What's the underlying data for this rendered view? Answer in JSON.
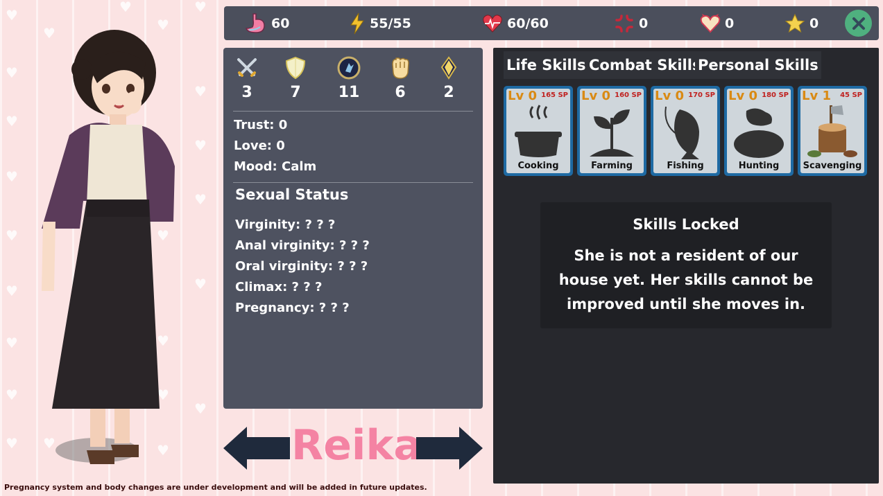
{
  "top_bar": {
    "stats": [
      {
        "icon": "stomach-icon",
        "value": "60"
      },
      {
        "icon": "energy-bolt-icon",
        "value": "55/55"
      },
      {
        "icon": "health-heart-icon",
        "value": "60/60"
      },
      {
        "icon": "anger-icon",
        "value": "0"
      },
      {
        "icon": "demon-heart-icon",
        "value": "0"
      },
      {
        "icon": "star-icon",
        "value": "0"
      }
    ],
    "close_icon": "close-icon"
  },
  "attributes": [
    {
      "icon": "crossed-swords-icon",
      "value": "3"
    },
    {
      "icon": "shield-icon",
      "value": "7"
    },
    {
      "icon": "agility-emblem-icon",
      "value": "11"
    },
    {
      "icon": "fist-icon",
      "value": "6"
    },
    {
      "icon": "crystal-icon",
      "value": "2"
    }
  ],
  "relationship": {
    "trust": "Trust: 0",
    "love": "Love: 0",
    "mood": "Mood: Calm"
  },
  "sexual_status": {
    "title": "Sexual Status",
    "lines": [
      "Virginity: ? ? ?",
      "Anal virginity: ? ? ?",
      "Oral virginity: ? ? ?",
      "Climax: ? ? ?",
      "Pregnancy: ? ? ?"
    ]
  },
  "character": {
    "name": "Reika"
  },
  "skills": {
    "tabs": [
      "Life Skills",
      "Combat Skills",
      "Personal Skills"
    ],
    "cards": [
      {
        "level": "Lv 0",
        "sp": "165 SP",
        "name": "Cooking",
        "icon": "cooking-pot-icon"
      },
      {
        "level": "Lv 0",
        "sp": "160 SP",
        "name": "Farming",
        "icon": "sprout-icon"
      },
      {
        "level": "Lv 0",
        "sp": "170 SP",
        "name": "Fishing",
        "icon": "fish-hook-icon"
      },
      {
        "level": "Lv 0",
        "sp": "180 SP",
        "name": "Hunting",
        "icon": "rabbit-icon"
      },
      {
        "level": "Lv 1",
        "sp": "45 SP",
        "name": "Scavenging",
        "icon": "axe-stump-icon"
      }
    ],
    "locked": {
      "title": "Skills Locked",
      "message": "She is not a resident of our house yet. Her skills cannot be improved until she moves in."
    }
  },
  "footer_note": "Pregnancy system and body changes are under development and will be added in future updates."
}
